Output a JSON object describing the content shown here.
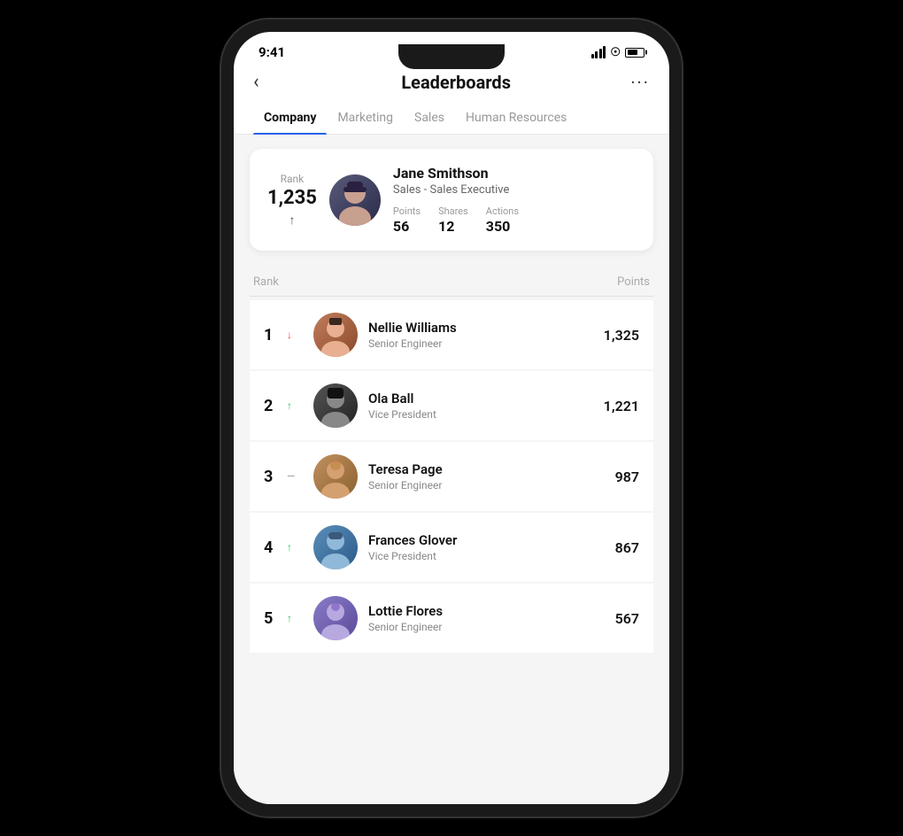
{
  "statusBar": {
    "time": "9:41",
    "icons": [
      "signal",
      "wifi",
      "battery"
    ]
  },
  "header": {
    "title": "Leaderboards",
    "backLabel": "‹",
    "moreLabel": "···"
  },
  "tabs": [
    {
      "id": "company",
      "label": "Company",
      "active": true
    },
    {
      "id": "marketing",
      "label": "Marketing",
      "active": false
    },
    {
      "id": "sales",
      "label": "Sales",
      "active": false
    },
    {
      "id": "hr",
      "label": "Human Resources",
      "active": false
    }
  ],
  "myCard": {
    "rankLabel": "Rank",
    "rankNumber": "1,235",
    "trendArrow": "↑",
    "name": "Jane Smithson",
    "role": "Sales - Sales Executive",
    "stats": [
      {
        "label": "Points",
        "value": "56"
      },
      {
        "label": "Shares",
        "value": "12"
      },
      {
        "label": "Actions",
        "value": "350"
      }
    ]
  },
  "listHeaders": {
    "rank": "Rank",
    "points": "Points"
  },
  "leaderboard": [
    {
      "rank": "1",
      "trend": "↓",
      "trendType": "down",
      "name": "Nellie Williams",
      "role": "Senior Engineer",
      "points": "1,325",
      "avatarClass": "av-1"
    },
    {
      "rank": "2",
      "trend": "↑",
      "trendType": "up",
      "name": "Ola Ball",
      "role": "Vice President",
      "points": "1,221",
      "avatarClass": "av-2"
    },
    {
      "rank": "3",
      "trend": "—",
      "trendType": "neutral",
      "name": "Teresa Page",
      "role": "Senior Engineer",
      "points": "987",
      "avatarClass": "av-3"
    },
    {
      "rank": "4",
      "trend": "↑",
      "trendType": "up",
      "name": "Frances Glover",
      "role": "Vice President",
      "points": "867",
      "avatarClass": "av-4"
    },
    {
      "rank": "5",
      "trend": "↑",
      "trendType": "up",
      "name": "Lottie Flores",
      "role": "Senior Engineer",
      "points": "567",
      "avatarClass": "av-5"
    }
  ]
}
